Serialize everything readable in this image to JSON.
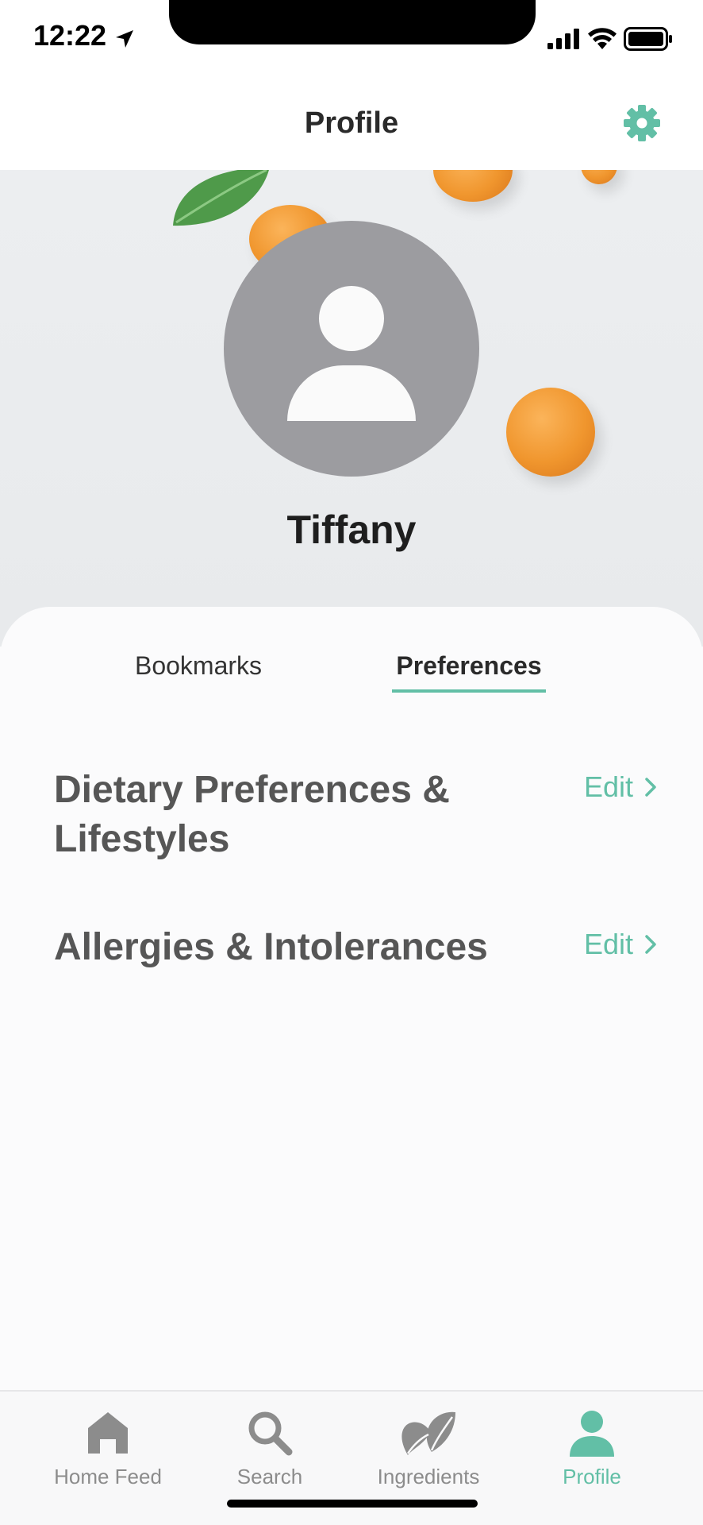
{
  "status_bar": {
    "time": "12:22",
    "icons": [
      "location-arrow-icon",
      "signal-icon",
      "wifi-icon",
      "battery-icon"
    ]
  },
  "header": {
    "title": "Profile",
    "settings_icon": "gear-icon"
  },
  "profile": {
    "name": "Tiffany",
    "avatar_icon": "user-placeholder-icon"
  },
  "tabs": [
    {
      "label": "Bookmarks",
      "active": false
    },
    {
      "label": "Preferences",
      "active": true
    }
  ],
  "preferences": [
    {
      "title": "Dietary Preferences & Lifestyles",
      "action": "Edit"
    },
    {
      "title": "Allergies & Intolerances",
      "action": "Edit"
    }
  ],
  "bottom_nav": [
    {
      "label": "Home Feed",
      "icon": "home-icon",
      "active": false
    },
    {
      "label": "Search",
      "icon": "search-icon",
      "active": false
    },
    {
      "label": "Ingredients",
      "icon": "leaves-icon",
      "active": false
    },
    {
      "label": "Profile",
      "icon": "person-icon",
      "active": true
    }
  ],
  "colors": {
    "accent": "#62bfa6",
    "inactive": "#8c8c8c",
    "avatar": "#9c9ca0"
  }
}
